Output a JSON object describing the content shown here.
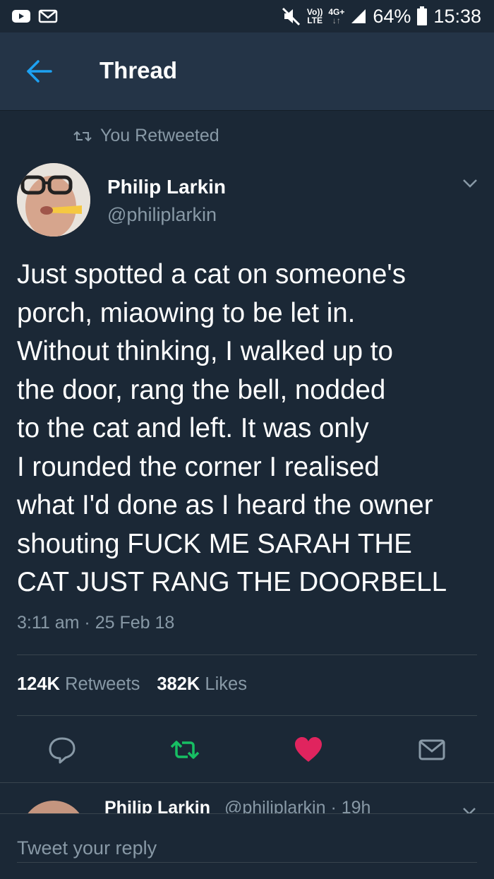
{
  "status_bar": {
    "network_top": "Vo))",
    "network_bottom": "LTE",
    "data_top": "4G+",
    "data_bottom": "↓↑",
    "battery": "64%",
    "time": "15:38"
  },
  "header": {
    "title": "Thread"
  },
  "tweet": {
    "retweet_label": "You Retweeted",
    "author_name": "Philip Larkin",
    "author_handle": "@philiplarkin",
    "text_lines": [
      "Just spotted a cat on someone's",
      "porch, miaowing to be let in.",
      "Without thinking, I walked up to",
      "the door, rang the bell, nodded",
      "to the cat and left. It was only",
      "I rounded the corner I realised",
      "what I'd done as I heard the owner",
      "shouting FUCK ME SARAH THE",
      "CAT JUST RANG THE DOORBELL"
    ],
    "timestamp": "3:11 am · 25 Feb 18",
    "retweet_count": "124K",
    "retweet_word": "Retweets",
    "like_count": "382K",
    "like_word": "Likes"
  },
  "next_tweet": {
    "author_name": "Philip Larkin",
    "meta": "@philiplarkin · 19h"
  },
  "reply": {
    "placeholder": "Tweet your reply"
  },
  "colors": {
    "background": "#1b2836",
    "header": "#243447",
    "accent": "#1da1f2",
    "retweet_green": "#17bf63",
    "like_red": "#e0245e",
    "muted": "#8899a6"
  }
}
